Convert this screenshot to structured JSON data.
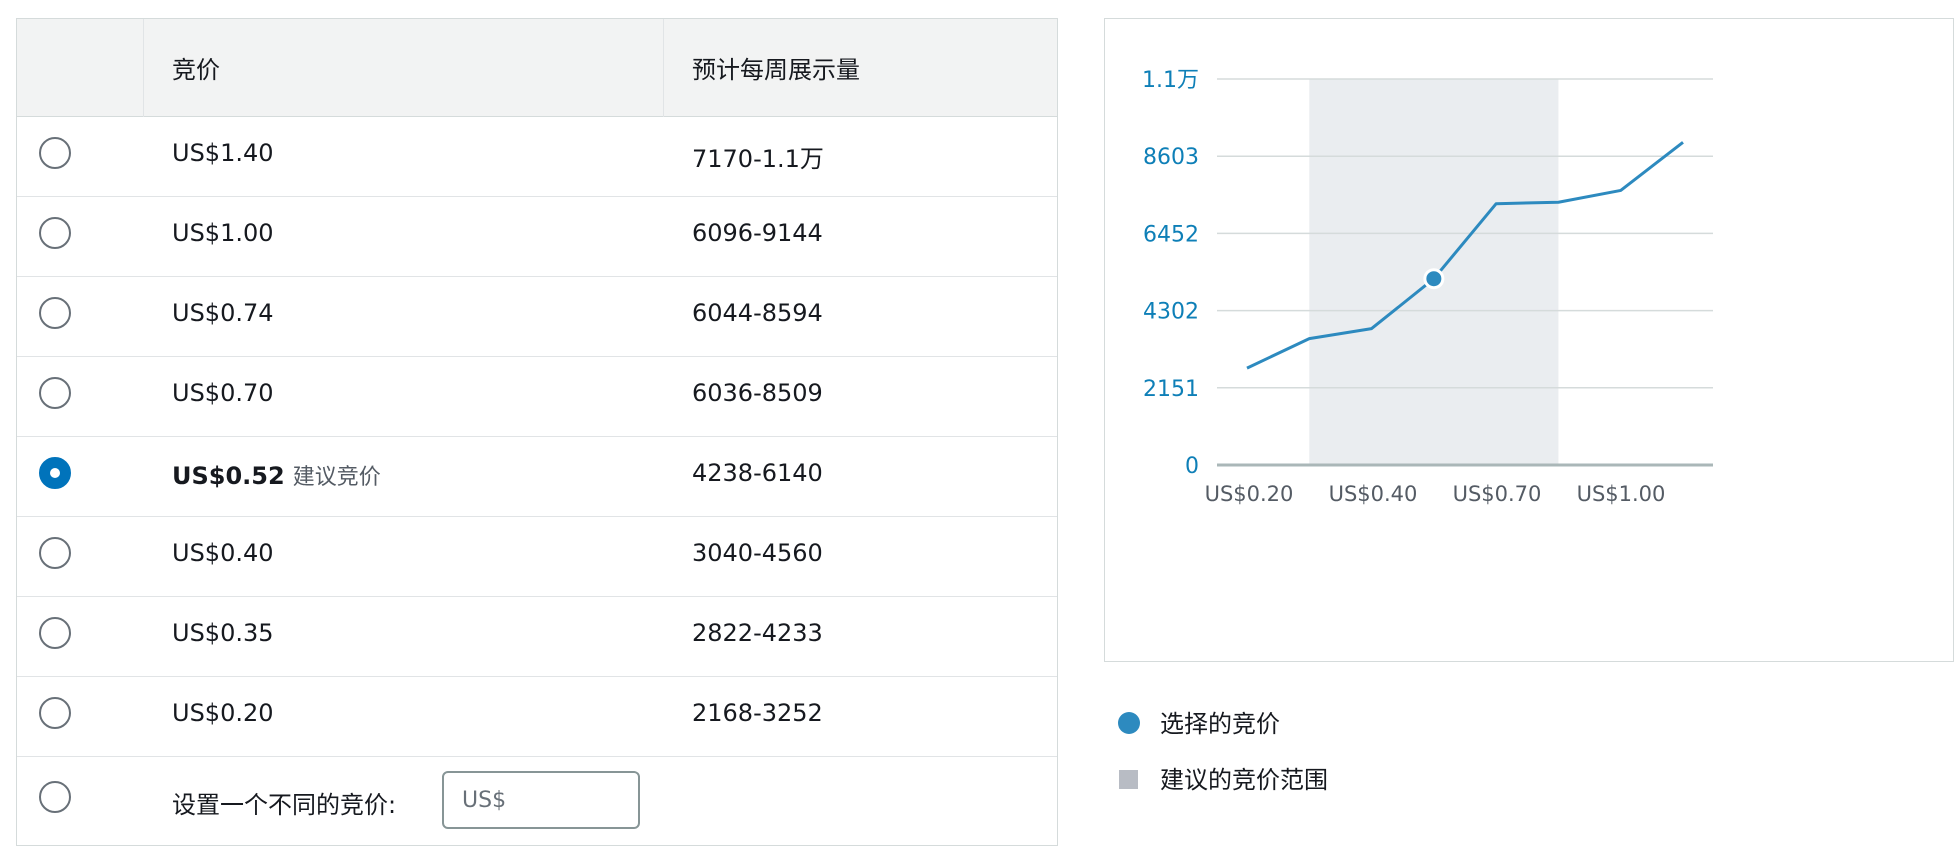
{
  "table": {
    "headers": [
      "",
      "竞价",
      "预计每周展示量"
    ],
    "rows": [
      {
        "bid": "US$1.40",
        "impressions": "7170-1.1万",
        "selected": false,
        "tag": ""
      },
      {
        "bid": "US$1.00",
        "impressions": "6096-9144",
        "selected": false,
        "tag": ""
      },
      {
        "bid": "US$0.74",
        "impressions": "6044-8594",
        "selected": false,
        "tag": ""
      },
      {
        "bid": "US$0.70",
        "impressions": "6036-8509",
        "selected": false,
        "tag": ""
      },
      {
        "bid": "US$0.52",
        "impressions": "4238-6140",
        "selected": true,
        "tag": "建议竞价"
      },
      {
        "bid": "US$0.40",
        "impressions": "3040-4560",
        "selected": false,
        "tag": ""
      },
      {
        "bid": "US$0.35",
        "impressions": "2822-4233",
        "selected": false,
        "tag": ""
      },
      {
        "bid": "US$0.20",
        "impressions": "2168-3252",
        "selected": false,
        "tag": ""
      }
    ],
    "custom": {
      "label": "设置一个不同的竞价:",
      "placeholder": "US$",
      "value": ""
    }
  },
  "colors": {
    "accent": "#0073bb",
    "line": "#2d8abf",
    "axis_text": "#0e7fb7",
    "suggested_band": "#eaedf0",
    "legend_square": "#b8bcc4"
  },
  "chart_data": {
    "type": "line",
    "x_tick_labels": [
      "US$0.20",
      "US$0.40",
      "US$0.70",
      "US$1.00"
    ],
    "y_tick_labels": [
      "0",
      "2151",
      "4302",
      "6452",
      "8603",
      "1.1万"
    ],
    "ylim": [
      0,
      10754
    ],
    "series": [
      {
        "name": "",
        "x": [
          0.2,
          0.35,
          0.4,
          0.52,
          0.7,
          0.74,
          1.0,
          1.4
        ],
        "y": [
          2700,
          3520,
          3800,
          5190,
          7280,
          7320,
          7650,
          8990
        ]
      }
    ],
    "selected_bid": {
      "x": 0.52,
      "y": 5190
    },
    "suggested_range": {
      "from": 0.35,
      "to": 0.74
    },
    "grid": true,
    "legend": [
      {
        "label": "选择的竞价",
        "marker": "dot"
      },
      {
        "label": "建议的竞价范围",
        "marker": "square"
      }
    ]
  }
}
